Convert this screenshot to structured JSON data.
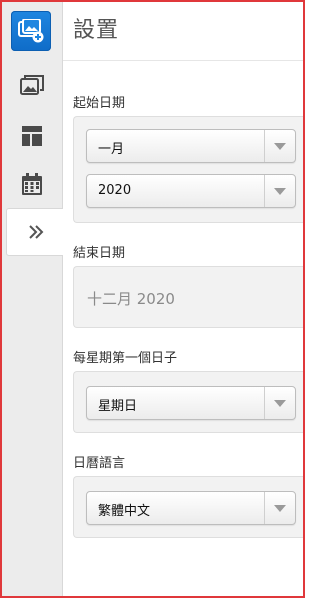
{
  "header": {
    "title": "設置"
  },
  "sidebar": {
    "items": [
      {
        "icon": "app-add-photo-icon"
      },
      {
        "icon": "photo-gallery-icon"
      },
      {
        "icon": "layout-icon"
      },
      {
        "icon": "calendar-icon"
      },
      {
        "icon": "double-chevron-right-icon"
      }
    ]
  },
  "settings": {
    "start_date": {
      "label": "起始日期",
      "month_value": "一月",
      "year_value": "2020"
    },
    "end_date": {
      "label": "結束日期",
      "value": "十二月 2020"
    },
    "first_day": {
      "label": "每星期第一個日子",
      "value": "星期日"
    },
    "language": {
      "label": "日曆語言",
      "value": "繁體中文"
    }
  },
  "colors": {
    "accent": "#1f86e0",
    "frame_border": "#e0383b"
  }
}
